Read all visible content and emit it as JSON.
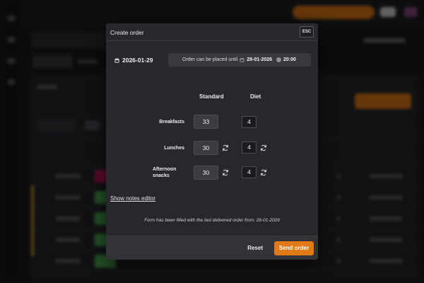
{
  "modal": {
    "title": "Create order",
    "esc_label": "ESC",
    "date": "2026-01-29",
    "deadline_text": "Order can be placed until",
    "deadline_date": "28-01-2026",
    "deadline_time": "20:00",
    "columns": {
      "standard": "Standard",
      "diet": "Diet"
    },
    "rows": {
      "breakfasts": {
        "label": "Breakfasts",
        "standard": "33",
        "diet": "4"
      },
      "lunches": {
        "label": "Lunches",
        "standard": "30",
        "diet": "4"
      },
      "snacks": {
        "label_line1": "Afternoon",
        "label_line2": "snacks",
        "standard": "30",
        "diet": "4"
      }
    },
    "notes_link": "Show notes editor",
    "info_text": "Form has been filled with the last delivered order from: 26-01-2026",
    "reset_label": "Reset",
    "send_label": "Send order"
  },
  "colors": {
    "accent": "#e07a16",
    "modal_bg": "#27282b"
  }
}
